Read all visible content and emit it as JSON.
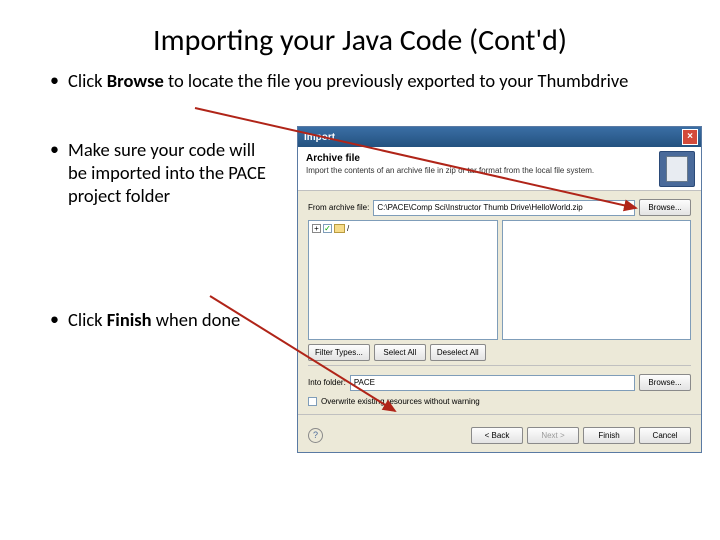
{
  "title": "Importing your Java Code (Cont'd)",
  "bullets": {
    "b1_pre": "Click ",
    "b1_bold": "Browse",
    "b1_post": " to locate the file you previously exported to your Thumbdrive",
    "b2": "Make sure your code will be imported into the PACE project folder",
    "b3_pre": "Click ",
    "b3_bold": "Finish",
    "b3_post": " when done"
  },
  "dialog": {
    "window_title": "Import",
    "header_title": "Archive file",
    "header_sub": "Import the contents of an archive file in zip or tar format from the local file system.",
    "from_label": "From archive file:",
    "from_value": "C:\\PACE\\Comp Sci\\Instructor Thumb Drive\\HelloWorld.zip",
    "browse": "Browse...",
    "tree_root": "/",
    "filter_types": "Filter Types...",
    "select_all": "Select All",
    "deselect_all": "Deselect All",
    "into_label": "Into folder:",
    "into_value": "PACE",
    "overwrite": "Overwrite existing resources without warning",
    "back": "< Back",
    "next": "Next >",
    "finish": "Finish",
    "cancel": "Cancel"
  }
}
